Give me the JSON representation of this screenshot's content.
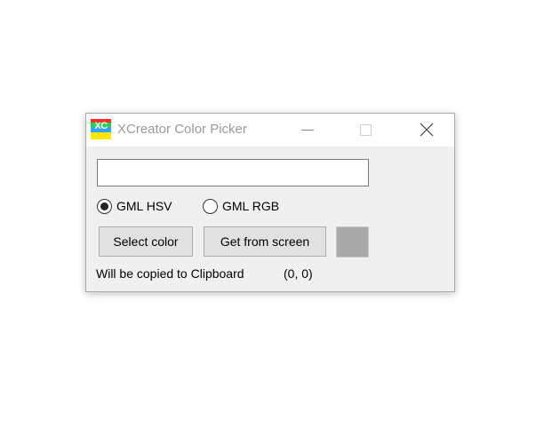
{
  "window": {
    "title": "XCreator Color Picker",
    "icon_name": "xcreator-app-icon",
    "icon_letters": "XC"
  },
  "controls": {
    "minimize_icon": "minimize-icon",
    "maximize_icon": "maximize-icon",
    "close_icon": "close-icon"
  },
  "color_input": {
    "value": "",
    "placeholder": ""
  },
  "format_options": [
    {
      "label": "GML HSV",
      "selected": true
    },
    {
      "label": "GML RGB",
      "selected": false
    }
  ],
  "buttons": {
    "select_color": "Select color",
    "get_from_screen": "Get from screen"
  },
  "preview": {
    "color": "#a9a9a9"
  },
  "status": {
    "copy_note": "Will be copied to Clipboard",
    "coordinates": "(0, 0)"
  }
}
